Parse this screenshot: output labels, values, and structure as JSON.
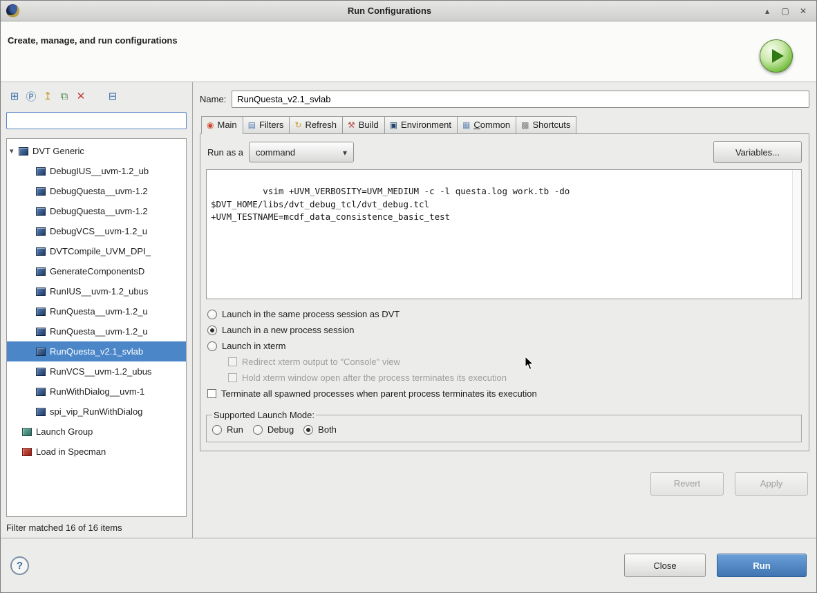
{
  "window": {
    "title": "Run Configurations",
    "controls": [
      {
        "name": "shade-button",
        "glyph": "▴"
      },
      {
        "name": "maximize-button",
        "glyph": "▢"
      },
      {
        "name": "close-button",
        "glyph": "✕"
      }
    ]
  },
  "header": {
    "title": "Create, manage, and run configurations"
  },
  "sidebar": {
    "toolbar": [
      {
        "name": "new-config-icon",
        "glyph": "⊞",
        "color": "#3f6fae",
        "gap": false
      },
      {
        "name": "new-prototype-icon",
        "glyph": "Ⓟ",
        "color": "#3f6fae",
        "gap": false
      },
      {
        "name": "export-icon",
        "glyph": "↥",
        "color": "#c79a2e",
        "gap": false
      },
      {
        "name": "duplicate-icon",
        "glyph": "⧉",
        "color": "#4e8a57",
        "gap": false
      },
      {
        "name": "delete-icon",
        "glyph": "✕",
        "color": "#c03b2e",
        "gap": false
      },
      {
        "name": "collapse-all-icon",
        "glyph": "⊟",
        "color": "#3f6fae",
        "gap": true
      }
    ],
    "filter_value": "",
    "tree": {
      "root": {
        "label": "DVT Generic",
        "icon": "config"
      },
      "children": [
        "DebugIUS__uvm-1.2_ub",
        "DebugQuesta__uvm-1.2",
        "DebugQuesta__uvm-1.2",
        "DebugVCS__uvm-1.2_u",
        "DVTCompile_UVM_DPI_",
        "GenerateComponentsD",
        "RunIUS__uvm-1.2_ubus",
        "RunQuesta__uvm-1.2_u",
        "RunQuesta__uvm-1.2_u",
        "RunQuesta_v2.1_svlab",
        "RunVCS__uvm-1.2_ubus",
        "RunWithDialog__uvm-1",
        "spi_vip_RunWithDialog"
      ],
      "selected_index": 9,
      "siblings": [
        {
          "label": "Launch Group",
          "icon": "launch-group"
        },
        {
          "label": "Load in Specman",
          "icon": "specman"
        }
      ]
    },
    "status": "Filter matched 16 of 16 items"
  },
  "main": {
    "name_label": "Name:",
    "name_value": "RunQuesta_v2.1_svlab",
    "tabs": [
      {
        "label": "Main",
        "selected": true,
        "icon": "main-tab-icon",
        "glyph": "◉",
        "color": "#cf4a31",
        "mnemonic": null
      },
      {
        "label": "Filters",
        "selected": false,
        "icon": "filters-tab-icon",
        "glyph": "▤",
        "color": "#5b7fb4",
        "mnemonic": null
      },
      {
        "label": "Refresh",
        "selected": false,
        "icon": "refresh-tab-icon",
        "glyph": "↻",
        "color": "#c9a227",
        "mnemonic": null
      },
      {
        "label": "Build",
        "selected": false,
        "icon": "build-tab-icon",
        "glyph": "⚒",
        "color": "#b5443c",
        "mnemonic": null
      },
      {
        "label": "Environment",
        "selected": false,
        "icon": "environment-tab-icon",
        "glyph": "▣",
        "color": "#23456e",
        "mnemonic": null
      },
      {
        "label": "Common",
        "selected": false,
        "icon": "common-tab-icon",
        "glyph": "▦",
        "color": "#6a89b5",
        "mnemonic": 0
      },
      {
        "label": "Shortcuts",
        "selected": false,
        "icon": "shortcuts-tab-icon",
        "glyph": "▩",
        "color": "#7d7d7d",
        "mnemonic": null
      }
    ],
    "run_as_label": "Run as a",
    "run_as_value": "command",
    "variables_button": "Variables...",
    "command_text": "vsim +UVM_VERBOSITY=UVM_MEDIUM -c -l questa.log work.tb -do\n$DVT_HOME/libs/dvt_debug_tcl/dvt_debug.tcl\n+UVM_TESTNAME=mcdf_data_consistence_basic_test",
    "process_options": [
      {
        "label": "Launch in the same process session as DVT",
        "selected": false
      },
      {
        "label": "Launch in a new process session",
        "selected": true
      },
      {
        "label": "Launch in xterm",
        "selected": false
      }
    ],
    "xterm_options": [
      {
        "label": "Redirect xterm output to \"Console\" view",
        "checked": false,
        "enabled": false
      },
      {
        "label": "Hold xterm window open after the process terminates its execution",
        "checked": false,
        "enabled": false
      }
    ],
    "terminate_option": {
      "label": "Terminate all spawned processes when parent process terminates its execution",
      "checked": false
    },
    "launch_mode": {
      "label": "Supported Launch Mode:",
      "options": [
        {
          "label": "Run",
          "selected": false
        },
        {
          "label": "Debug",
          "selected": false
        },
        {
          "label": "Both",
          "selected": true
        }
      ]
    },
    "revert_button": "Revert",
    "apply_button": "Apply"
  },
  "footer": {
    "help_glyph": "?",
    "close_button": "Close",
    "run_button": "Run"
  },
  "colors": {
    "selection": "#4a86c8",
    "run_button": "#3f74b2",
    "play_badge": "#4f9426"
  }
}
